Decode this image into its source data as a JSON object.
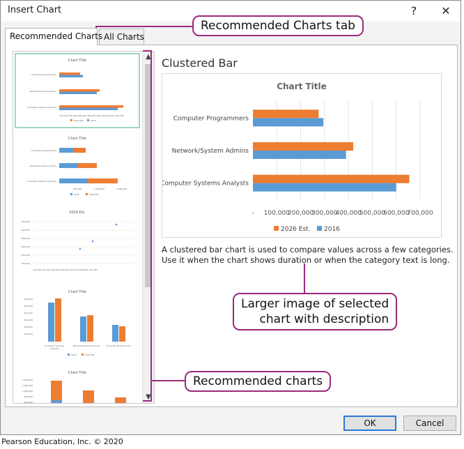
{
  "dialog": {
    "title": "Insert Chart",
    "help_label": "?",
    "close_label": "✕"
  },
  "tabs": [
    {
      "label": "Recommended Charts",
      "active": true
    },
    {
      "label": "All Charts",
      "active": false
    }
  ],
  "thumbnails": [
    {
      "title": "Chart Title",
      "type": "clustered-bar",
      "selected": true
    },
    {
      "title": "Chart Title",
      "type": "stacked-bar",
      "selected": false
    },
    {
      "title": "2026 Est.",
      "type": "scatter",
      "selected": false
    },
    {
      "title": "Chart Title",
      "type": "clustered-column",
      "selected": false
    },
    {
      "title": "Chart Title",
      "type": "stacked-column",
      "selected": false
    }
  ],
  "scrollbar": {
    "up_icon": "chevron-up-icon",
    "down_icon": "chevron-down-icon"
  },
  "preview": {
    "heading": "Clustered Bar",
    "description": "A clustered bar chart is used to compare values across a few categories. Use it when the chart shows duration or when the category text is long."
  },
  "chart_data": {
    "type": "bar",
    "orientation": "horizontal",
    "title": "Chart Title",
    "categories": [
      "Computer Programmers",
      "Network/System Admins",
      "Computer Systems Analysts"
    ],
    "series": [
      {
        "name": "2026 Est.",
        "values": [
          275000,
          420000,
          655000
        ],
        "color": "#ed7d31"
      },
      {
        "name": "2016",
        "values": [
          295000,
          390000,
          600000
        ],
        "color": "#5b9bd5"
      }
    ],
    "xlim": [
      0,
      700000
    ],
    "xticks": [
      "-",
      "100,000",
      "200,000",
      "300,000",
      "400,000",
      "500,000",
      "600,000",
      "700,000"
    ],
    "grid": true,
    "legend": "bottom"
  },
  "buttons": {
    "ok": "OK",
    "cancel": "Cancel"
  },
  "callouts": {
    "tab": "Recommended Charts tab",
    "preview_line1": "Larger image of selected",
    "preview_line2": "chart with description",
    "charts": "Recommended charts"
  },
  "colors": {
    "accent": "#9b2a7a",
    "orange": "#ed7d31",
    "blue": "#5b9bd5",
    "ok_border": "#2a78d6"
  },
  "footer": "Pearson Education, Inc. © 2020"
}
